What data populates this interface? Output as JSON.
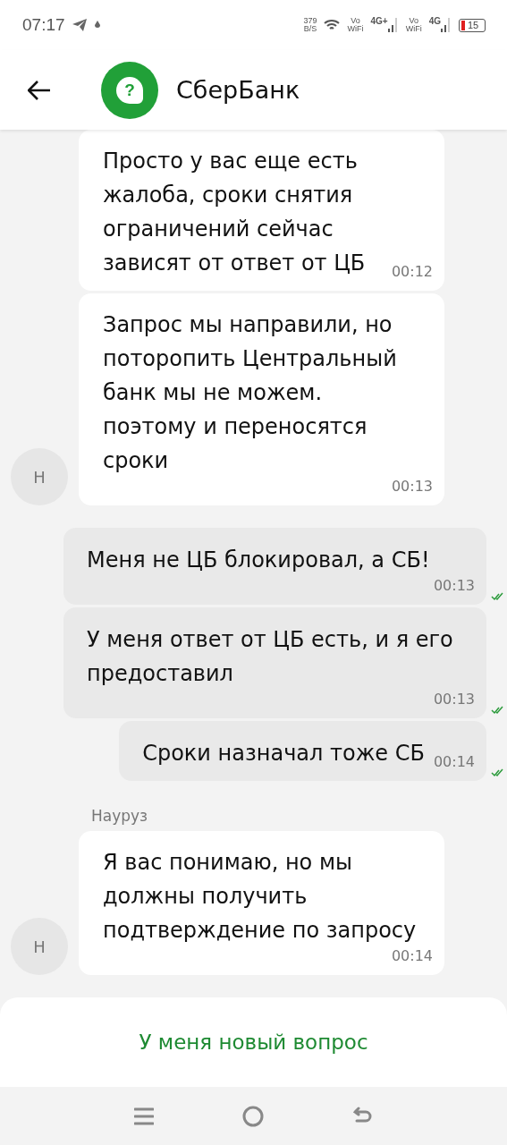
{
  "status_bar": {
    "time": "07:17",
    "net_speed": "379",
    "net_speed_unit": "B/S",
    "sims": [
      {
        "vo": "Vo",
        "wifi": "WiFi",
        "network": "4G+"
      },
      {
        "vo": "Vo",
        "wifi": "WiFi",
        "network": "4G"
      }
    ],
    "battery": "15"
  },
  "header": {
    "logo_symbol": "?",
    "title": "СберБанк"
  },
  "messages": [
    {
      "kind": "incoming",
      "text": "Просто у вас еще есть\nжалоба, сроки снятия\nограничений сейчас\nзависят от ответ от ЦБ",
      "time": "00:12"
    },
    {
      "kind": "incoming",
      "text": "Запрос мы направили, но\nпоторопить Центральный\nбанк мы не можем.\nпоэтому и переносятся\nсроки",
      "time": "00:13",
      "avatar": "Н"
    },
    {
      "kind": "outgoing",
      "text": "Меня не ЦБ блокировал, а СБ!",
      "time": "00:13",
      "read": true
    },
    {
      "kind": "outgoing",
      "text": "У меня ответ от ЦБ есть, и я его\nпредоставил",
      "time": "00:13",
      "read": true
    },
    {
      "kind": "outgoing",
      "text": "Сроки назначал тоже СБ",
      "time": "00:14",
      "read": true
    },
    {
      "kind": "sender",
      "text": "Науруз"
    },
    {
      "kind": "incoming",
      "text": "Я вас понимаю, но мы\nдолжны получить\nподтверждение по запросу",
      "time": "00:14",
      "avatar": "Н"
    },
    {
      "kind": "partial"
    }
  ],
  "new_question_button": "У меня новый вопрос"
}
